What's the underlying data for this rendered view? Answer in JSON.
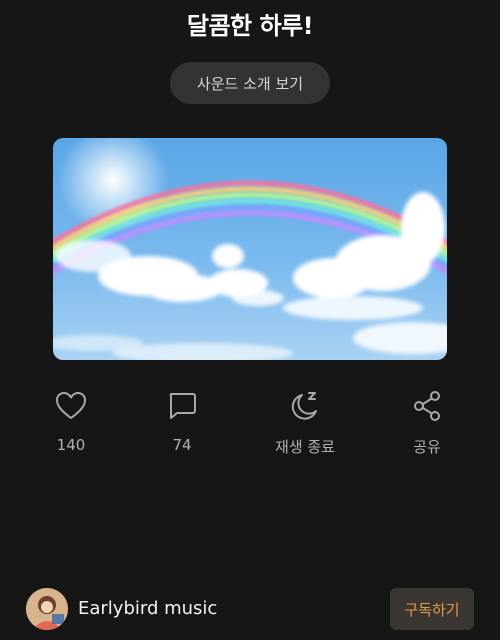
{
  "header": {
    "title": "달콤한 하루!"
  },
  "intro_button": {
    "label": "사운드 소개 보기"
  },
  "actions": [
    {
      "icon": "heart-icon",
      "label": "140"
    },
    {
      "icon": "comment-icon",
      "label": "74"
    },
    {
      "icon": "sleep-moon-icon",
      "label": "재생 종료"
    },
    {
      "icon": "share-icon",
      "label": "공유"
    }
  ],
  "footer": {
    "artist_name": "Earlybird music",
    "subscribe_label": "구독하기"
  },
  "colors": {
    "background": "#161616",
    "button_bg": "#333333",
    "accent": "#e39a4a",
    "icon": "#a8a8a8"
  }
}
